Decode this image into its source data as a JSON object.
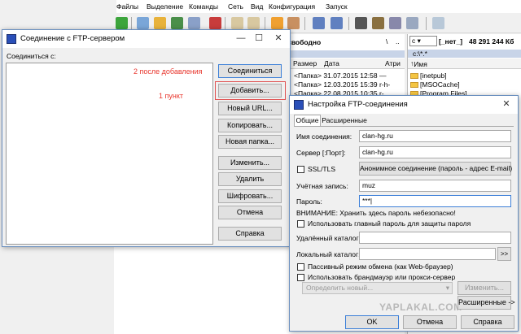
{
  "menu": [
    "Файлы",
    "Выделение",
    "Команды",
    "Сеть",
    "Вид",
    "Конфигурация",
    "Запуск"
  ],
  "left_panel": {
    "free_space": "5 свободно",
    "backslash": "\\",
    "dotdot": "..",
    "columns": [
      "я",
      "Размер",
      "Дата",
      "Атри"
    ],
    "rows": [
      {
        "size": "<Папка>",
        "date": "31.07.2015 12:58",
        "attr": "—"
      },
      {
        "size": "<Папка>",
        "date": "12.03.2015 15:39",
        "attr": "r-h-"
      },
      {
        "size": "<Папка>",
        "date": "22.08.2015 10:35",
        "attr": "r-"
      }
    ]
  },
  "right_panel": {
    "drive": "c",
    "drive_label": "[_нет_]",
    "free_space": "48 291 244 Кб",
    "path": "c:\\*.*",
    "column": "Имя",
    "folders": [
      "[inetpub]",
      "[MSOCache]",
      "[Program Files]"
    ]
  },
  "ftp_connect": {
    "title": "Соединение с FTP-сервером",
    "connect_label": "Соединиться с:",
    "annotation_2": "2 после добавления",
    "annotation_1": "1 пункт",
    "buttons": {
      "connect": "Соединиться",
      "add": "Добавить...",
      "new_url": "Новый URL...",
      "copy": "Копировать...",
      "new_folder": "Новая папка...",
      "edit": "Изменить...",
      "delete": "Удалить",
      "encrypt": "Шифровать...",
      "cancel": "Отмена",
      "help": "Справка"
    }
  },
  "ftp_settings": {
    "title": "Настройка FTP-соединения",
    "tabs": [
      "Общие",
      "Расширенные"
    ],
    "labels": {
      "conn_name": "Имя соединения:",
      "server": "Сервер [:Порт]:",
      "ssl": "SSL/TLS",
      "account": "Учётная запись:",
      "password": "Пароль:",
      "warning": "ВНИМАНИЕ: Хранить здесь пароль небезопасно!",
      "master_pw": "Использовать главный пароль для защиты пароля",
      "remote_dir": "Удалённый каталог:",
      "local_dir": "Локальный каталог:",
      "passive": "Пассивный режим обмена (как Web-браузер)",
      "firewall": "Использовать брандмауэр или прокси-сервер"
    },
    "values": {
      "conn_name": "clan-hg.ru",
      "server": "clan-hg.ru",
      "account": "muz",
      "password": "***|",
      "remote_dir": "",
      "local_dir": ""
    },
    "buttons": {
      "anon": "Анонимное соединение (пароль - адрес E-mail)",
      "browse": ">>",
      "define_new": "Определить новый...",
      "edit": "Изменить...",
      "advanced": "Расширенные ->",
      "ok": "OK",
      "cancel": "Отмена",
      "help": "Справка"
    }
  },
  "watermark": "YAPLAKAL.COM"
}
